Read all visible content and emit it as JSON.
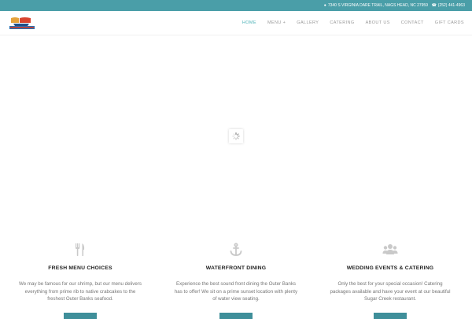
{
  "topbar": {
    "address_icon": "map-marker-icon",
    "address": "7340 S VIRGINIA DARE TRAIL, NAGS HEAD, NC 27959",
    "phone_icon": "phone-icon",
    "phone": "(252) 441-4963",
    "background": "#4a9ea8"
  },
  "header": {
    "logo_alt": "Sugar Creek",
    "nav": [
      {
        "label": "HOME"
      },
      {
        "label": "MENU +"
      },
      {
        "label": "GALLERY"
      },
      {
        "label": "CATERING"
      },
      {
        "label": "ABOUT US"
      },
      {
        "label": "CONTACT"
      },
      {
        "label": "GIFT CARDS"
      }
    ],
    "active_color": "#4fb3b8"
  },
  "features": [
    {
      "icon": "utensils-icon",
      "title": "FRESH MENU CHOICES",
      "text": "We may be famous for our shrimp, but our menu delivers everything from prime rib to native crabcakes to the freshest Outer Banks seafood."
    },
    {
      "icon": "anchor-icon",
      "title": "WATERFRONT DINING",
      "text": "Experience the best sound front dining the Outer Banks has to offer! We sit on a prime sunset location with plenty of water view seating."
    },
    {
      "icon": "group-icon",
      "title": "WEDDING EVENTS & CATERING",
      "text": "Only the best for your special occasion! Catering packages available and have your event at our beautiful Sugar Creek restaurant."
    }
  ],
  "button_color": "#3f8f9a"
}
